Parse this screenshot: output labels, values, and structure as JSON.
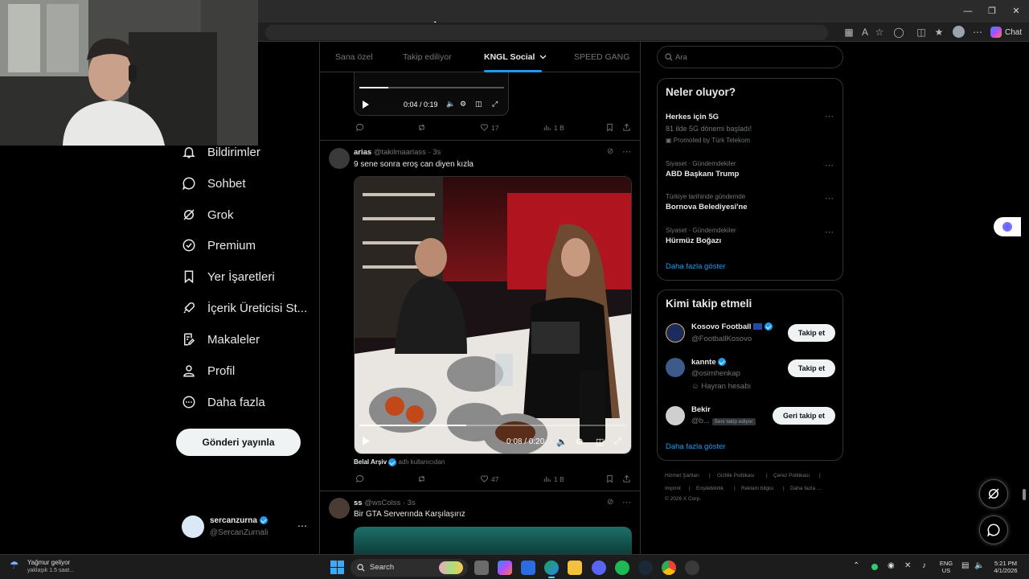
{
  "browser": {
    "chat_label": "Chat"
  },
  "nav": {
    "items": [
      {
        "label": "Bildirimler",
        "icon": "bell-icon"
      },
      {
        "label": "Sohbet",
        "icon": "chat-icon"
      },
      {
        "label": "Grok",
        "icon": "grok-icon"
      },
      {
        "label": "Premium",
        "icon": "premium-icon"
      },
      {
        "label": "Yer İşaretleri",
        "icon": "bookmark-icon"
      },
      {
        "label": "İçerik Üreticisi St...",
        "icon": "rocket-icon"
      },
      {
        "label": "Makaleler",
        "icon": "article-icon"
      },
      {
        "label": "Profil",
        "icon": "person-icon"
      },
      {
        "label": "Daha fazla",
        "icon": "more-circle-icon"
      }
    ],
    "post_button": "Gönderi yayınla",
    "account": {
      "name": "sercanzurna",
      "handle": "@SercanZurnali"
    }
  },
  "tabs": [
    "Sana özel",
    "Takip ediliyor",
    "KNGL Social",
    "SPEED GANG"
  ],
  "feed": {
    "post0": {
      "video_time": "0:04 / 0:19",
      "likes": "17",
      "views": "1 B"
    },
    "post1": {
      "name": "arias",
      "handle": "@takilmaarlass · 3s",
      "text": "9 sene sonra eroş can diyen kızla",
      "video_time": "0:08 / 0:20",
      "attribution_name": "Belal Arşiv",
      "attribution_suffix": "adlı kullanıcıdan",
      "likes": "47",
      "views": "1 B"
    },
    "post2": {
      "name": "ss",
      "handle": "@wsColss · 3s",
      "text": "Bir GTA Serverında Karşılaşırız"
    }
  },
  "sidebar": {
    "search_placeholder": "Ara",
    "trends_title": "Neler oluyor?",
    "trends": [
      {
        "title": "Herkes için 5G",
        "desc": "81 ilde 5G dönemi başladı!",
        "promo": "Promoted by Türk Telekom"
      },
      {
        "context": "Siyaset · Gündemdekiler",
        "title": "ABD Başkanı Trump"
      },
      {
        "context": "Türkiye tarihinde gündemde",
        "title": "Bornova Belediyesi'ne"
      },
      {
        "context": "Siyaset · Gündemdekiler",
        "title": "Hürmüz Boğazı"
      }
    ],
    "trends_more": "Daha fazla göster",
    "follow_title": "Kimi takip etmeli",
    "follow": [
      {
        "name": "Kosovo Football",
        "handle": "@FootballKosovo",
        "button": "Takip et"
      },
      {
        "name": "kannte",
        "handle": "@osimhenkap",
        "sub": "Hayran hesabı",
        "button": "Takip et"
      },
      {
        "name": "Bekir",
        "handle": "@b...",
        "badge": "Seni takip ediyor",
        "button": "Geri takip et"
      }
    ],
    "follow_more": "Daha fazla göster",
    "footer": [
      "Hizmet Şartları",
      "Gizlilik Politikası",
      "Çerez Politikası",
      "Imprint",
      "Erişilebilirlik",
      "Reklam bilgisi",
      "Daha fazla ...",
      "© 2026 X Corp."
    ]
  },
  "taskbar": {
    "weather_title": "Yağmur geliyor",
    "weather_sub": "yaklaşık 1.5 saat...",
    "search_label": "Search",
    "lang_top": "ENG",
    "lang_bottom": "US",
    "time": "5:21 PM",
    "date": "4/1/2026"
  }
}
